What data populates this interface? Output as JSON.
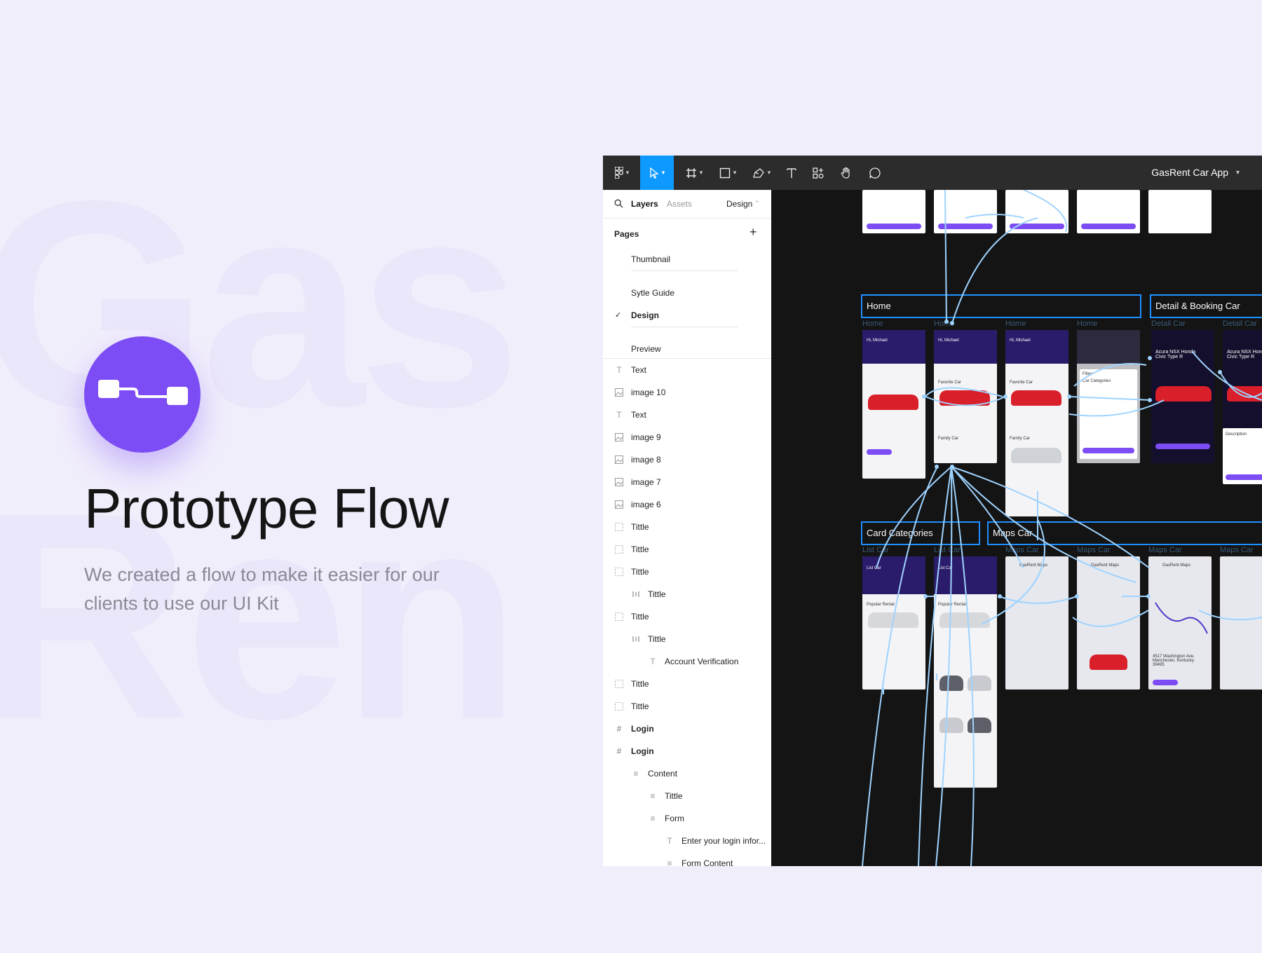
{
  "hero": {
    "title": "Prototype Flow",
    "subtitle": "We created a flow to make it easier for our clients to use our UI Kit"
  },
  "colors": {
    "accent": "#7c4cf4",
    "figma_blue": "#0d99ff",
    "canvas": "#141414"
  },
  "figma": {
    "file_name": "GasRent Car App",
    "tools": [
      "figma-menu-icon",
      "move-icon",
      "frame-icon",
      "shape-icon",
      "pen-icon",
      "text-icon",
      "components-icon",
      "hand-icon",
      "comment-icon"
    ],
    "tabs": {
      "layers": "Layers",
      "assets": "Assets",
      "design": "Design"
    },
    "pages_label": "Pages",
    "pages": [
      "Thumbnail",
      "Sytle Guide",
      "Design",
      "Preview"
    ],
    "layers": [
      {
        "label": "Text"
      },
      {
        "label": "image 10"
      },
      {
        "label": "Text"
      },
      {
        "label": "image 9"
      },
      {
        "label": "image 8"
      },
      {
        "label": "image 7"
      },
      {
        "label": "image 6"
      },
      {
        "label": "Tittle"
      },
      {
        "label": "Tittle"
      },
      {
        "label": "Tittle"
      },
      {
        "label": "Tittle"
      },
      {
        "label": "Tittle"
      },
      {
        "label": "Tittle"
      },
      {
        "label": "Account Verification"
      },
      {
        "label": "Tittle"
      },
      {
        "label": "Tittle"
      },
      {
        "label": "Login"
      },
      {
        "label": "Login"
      },
      {
        "label": "Content"
      },
      {
        "label": "Tittle"
      },
      {
        "label": "Form"
      },
      {
        "label": "Enter your login infor..."
      },
      {
        "label": "Form Content"
      }
    ],
    "canvas": {
      "sections": [
        "Home",
        "Detail & Booking Car",
        "Card Categories",
        "Maps Car"
      ],
      "frame_labels": {
        "home": [
          "Home",
          "Home",
          "Home",
          "Home"
        ],
        "detail": [
          "Detail Car",
          "Detail Car"
        ],
        "list": [
          "List Car",
          "List Car"
        ],
        "maps": [
          "Maps Car",
          "Maps Car",
          "Maps Car",
          "Maps Car"
        ]
      },
      "screen_text": {
        "greeting": "Hi, Michael",
        "favorite": "Favorite Car",
        "family": "Family Car",
        "filter": "Filter",
        "car_categories": "Car Categories",
        "detail_car": "Acura NSX Honda Civic Type R",
        "list_car": "List Car",
        "popular": "Popular Rental",
        "maps_title": "GasRent Maps",
        "address": "4517 Washington Ave. Manchester, Kentucky 39495",
        "description": "Description"
      }
    }
  }
}
